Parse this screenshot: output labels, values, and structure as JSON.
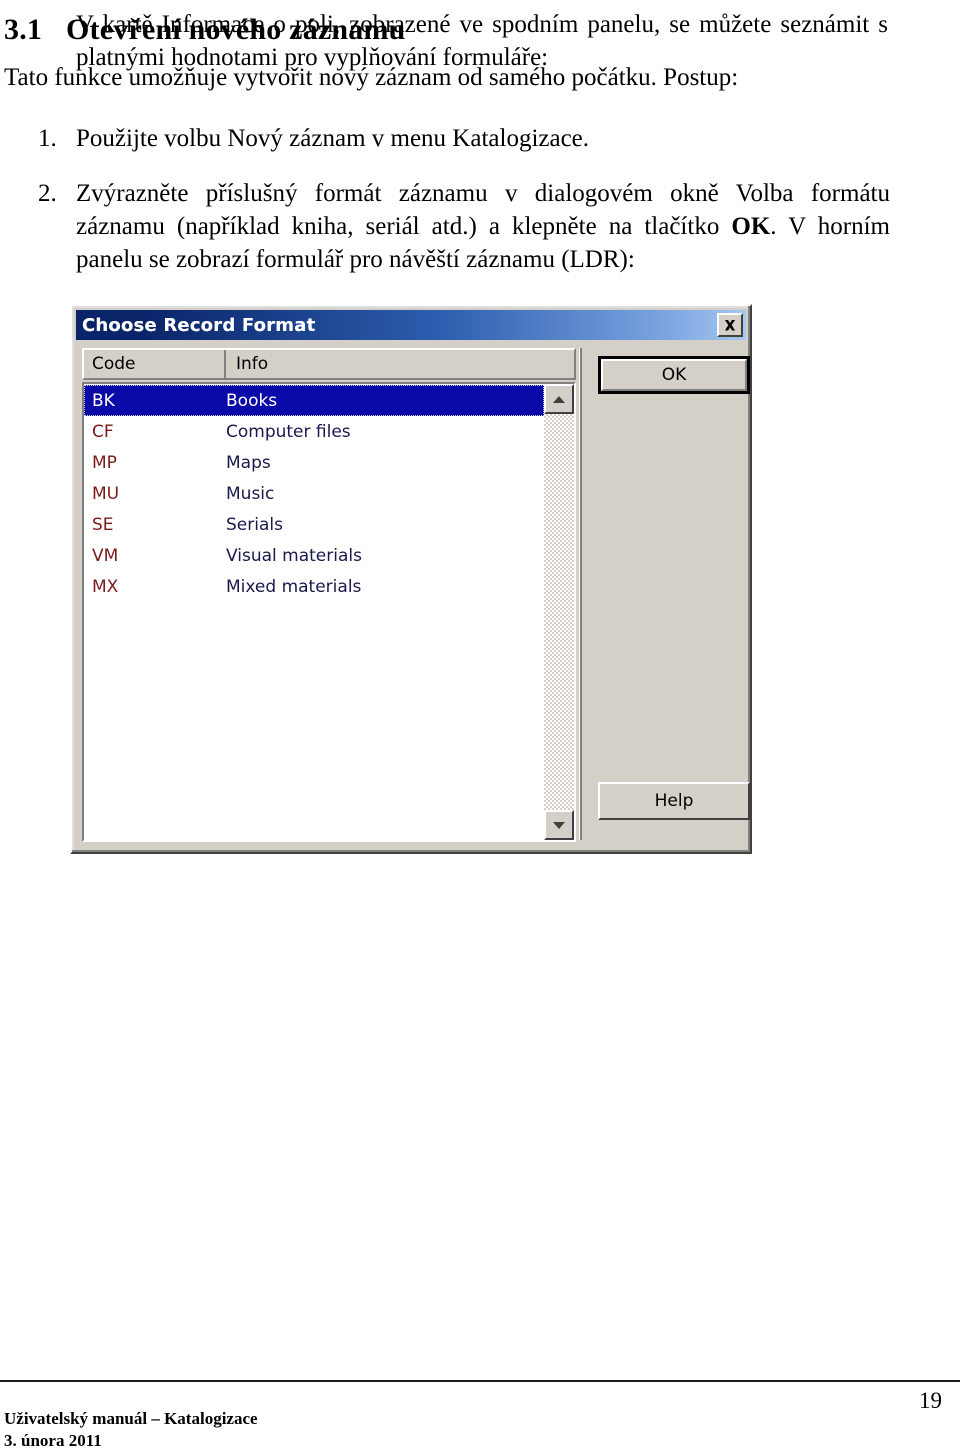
{
  "document": {
    "heading_number": "3.1",
    "heading_text": "Otevření nového záznamu",
    "intro": "Tato funkce umožňuje vytvořit nový záznam od samého počátku. Postup:",
    "steps": [
      {
        "marker": "1.",
        "text": "Použijte volbu Nový záznam v menu Katalogizace."
      },
      {
        "marker": "2.",
        "part1": "Zvýrazněte příslušný formát záznamu v dialogovém okně Volba formátu záznamu (například kniha, seriál atd.) a klepněte na tlačítko ",
        "bold": "OK",
        "part2": ". V horním panelu se zobrazí formulář pro návěští záznamu (LDR):"
      }
    ],
    "closing": "V kartě Informace o poli, zobrazené ve spodním panelu, se můžete seznámit s platnými hodnotami pro vyplňování formuláře:"
  },
  "dialog": {
    "title": "Choose Record Format",
    "close_label": "×",
    "columns": {
      "code": "Code",
      "info": "Info"
    },
    "rows": [
      {
        "code": "BK",
        "info": "Books",
        "selected": true
      },
      {
        "code": "CF",
        "info": "Computer files",
        "selected": false
      },
      {
        "code": "MP",
        "info": "Maps",
        "selected": false
      },
      {
        "code": "MU",
        "info": "Music",
        "selected": false
      },
      {
        "code": "SE",
        "info": "Serials",
        "selected": false
      },
      {
        "code": "VM",
        "info": "Visual materials",
        "selected": false
      },
      {
        "code": "MX",
        "info": "Mixed materials",
        "selected": false
      }
    ],
    "buttons": {
      "ok": "OK",
      "help": "Help"
    },
    "colors": {
      "titlebar_start": "#0a246a",
      "titlebar_end": "#a6c8f0",
      "face": "#d4d0c8",
      "selection": "#0a0aa8",
      "code_text": "#7b1a1a",
      "info_text": "#19194d"
    }
  },
  "footer": {
    "page_number": "19",
    "line1": "Uživatelský manuál – Katalogizace",
    "line2": "3. února 2011"
  }
}
